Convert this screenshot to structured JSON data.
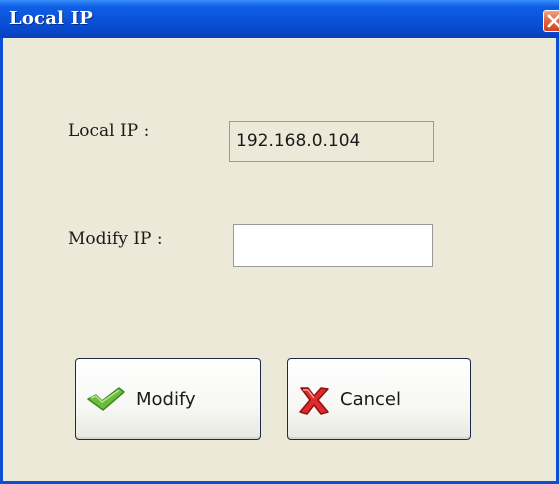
{
  "window": {
    "title": "Local IP"
  },
  "form": {
    "local_ip_label": "Local IP :",
    "local_ip_value": "192.168.0.104",
    "modify_ip_label": "Modify IP :",
    "modify_ip_value": ""
  },
  "buttons": {
    "modify_label": "Modify",
    "cancel_label": "Cancel"
  },
  "icons": {
    "close": "close-icon",
    "modify": "check-icon",
    "cancel": "x-icon"
  },
  "colors": {
    "titlebar": "#0a52d8",
    "dialog_bg": "#ece9d8",
    "check_green": "#5aa832",
    "cancel_red": "#d9252a"
  }
}
